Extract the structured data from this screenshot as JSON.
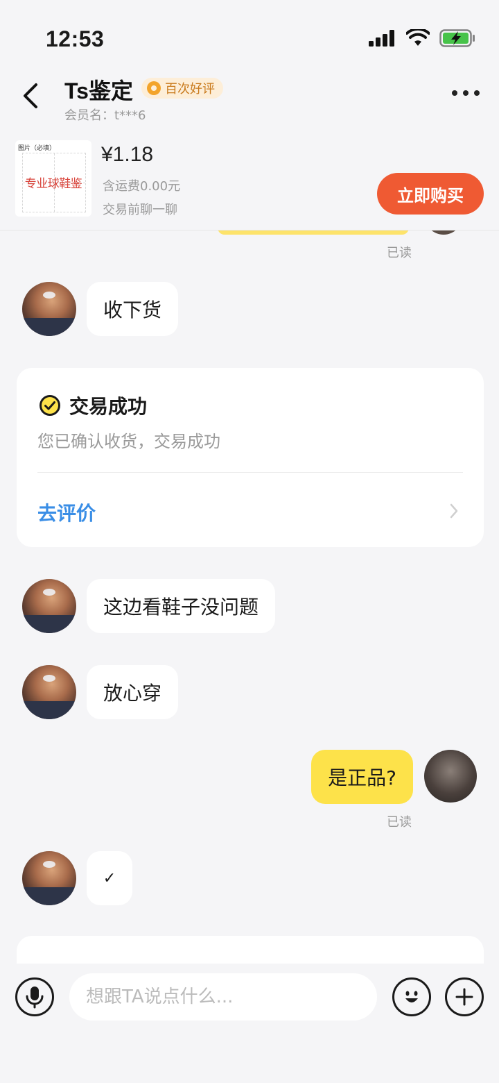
{
  "status_bar": {
    "time": "12:53"
  },
  "header": {
    "title": "Ts鉴定",
    "badge": "百次好评",
    "subtitle": "会员名：t***6"
  },
  "product": {
    "thumb_header": "图片（必填）",
    "thumb_text": "专业球鞋鉴",
    "price": "¥1.18",
    "shipping": "含运费0.00元",
    "note": "交易前聊一聊",
    "buy_label": "立即购买"
  },
  "chat": {
    "top_read": "已读",
    "messages": [
      {
        "side": "left",
        "text": "收下货"
      },
      {
        "side": "left",
        "text": "这边看鞋子没问题"
      },
      {
        "side": "left",
        "text": "放心穿"
      },
      {
        "side": "right",
        "text": "是正品?",
        "status": "已读"
      },
      {
        "side": "left",
        "text": "✓"
      }
    ],
    "trade_card": {
      "title": "交易成功",
      "description": "您已确认收货，交易成功",
      "link": "去评价"
    }
  },
  "input_bar": {
    "placeholder": "想跟TA说点什么..."
  },
  "colors": {
    "accent_yellow": "#fde24a",
    "buy_button": "#ef5a33",
    "link_blue": "#3a8ee6",
    "badge_bg": "#fdeed8"
  },
  "icons": [
    "back-arrow-icon",
    "more-dots-icon",
    "signal-icon",
    "wifi-icon",
    "battery-charging-icon",
    "check-circle-icon",
    "chevron-right-icon",
    "microphone-icon",
    "emoji-icon",
    "plus-icon"
  ]
}
